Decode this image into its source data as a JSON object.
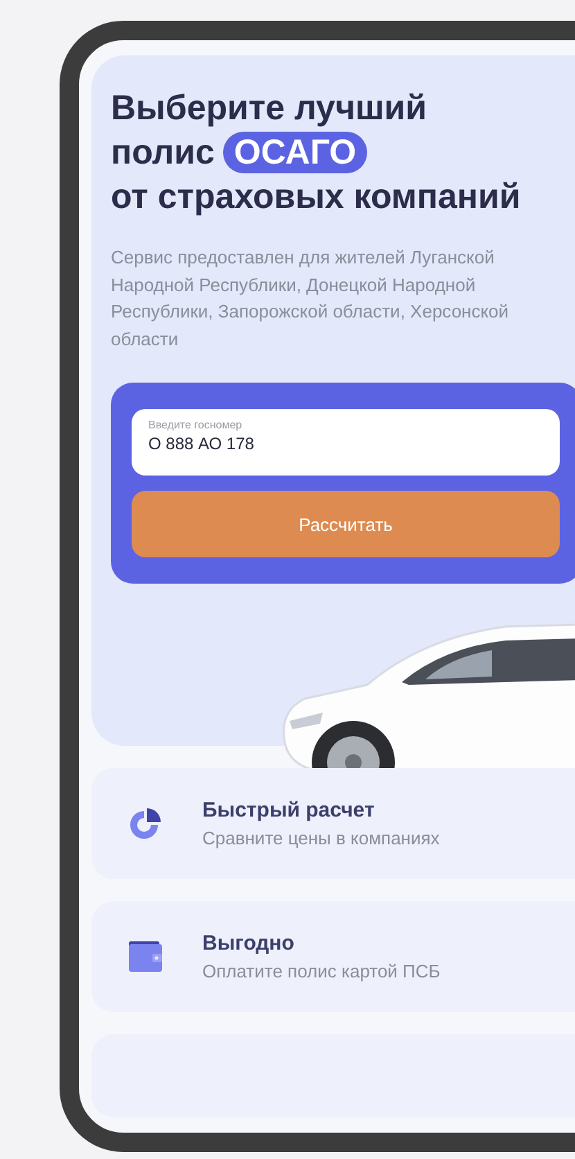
{
  "hero": {
    "title_lines": [
      "Выберите лучший",
      "полис",
      "от страховых компаний"
    ],
    "badge": "ОСАГО",
    "description": "Сервис предоставлен для жителей Луганской Народной Республики, Донецкой Народной Республики, Запорожской области, Херсонской области",
    "form": {
      "field_label": "Введите госномер",
      "field_value": "О 888 АО 178",
      "button": "Рассчитать"
    }
  },
  "features": [
    {
      "kind": "pie",
      "title": "Быстрый расчет",
      "subtitle": "Сравните цены в компаниях"
    },
    {
      "kind": "wallet",
      "title": "Выгодно",
      "subtitle": "Оплатите полис картой ПСБ"
    },
    {
      "kind": "cut"
    }
  ]
}
